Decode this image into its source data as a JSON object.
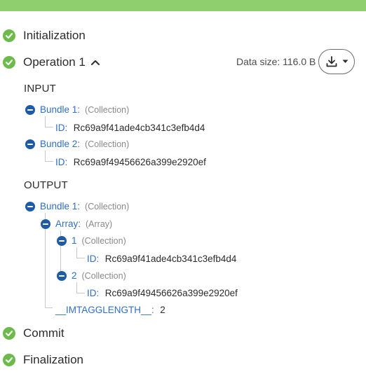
{
  "stages": {
    "initialization": "Initialization",
    "operation": "Operation 1",
    "commit": "Commit",
    "finalization": "Finalization"
  },
  "data_size": "Data size: 116.0 B",
  "icons": {
    "check": "check-circle-icon",
    "caret": "caret-up-icon",
    "download": "download-icon",
    "chevron": "chevron-down-icon",
    "collapse": "minus-circle-icon"
  },
  "colors": {
    "success": "#6cbb4a",
    "link": "#2f6fc2",
    "topbar": "#8fcf6e"
  },
  "input": {
    "heading": "INPUT",
    "bundle1": {
      "key": "Bundle 1:",
      "type": "(Collection)",
      "id_key": "ID:",
      "id_val": "Rc69a9f41ade4cb341c3efb4d4"
    },
    "bundle2": {
      "key": "Bundle 2:",
      "type": "(Collection)",
      "id_key": "ID:",
      "id_val": "Rc69a9f49456626a399e2920ef"
    }
  },
  "output": {
    "heading": "OUTPUT",
    "bundle1": {
      "key": "Bundle 1:",
      "type": "(Collection)"
    },
    "array": {
      "key": "Array:",
      "type": "(Array)"
    },
    "item1": {
      "key": "1",
      "type": "(Collection)",
      "id_key": "ID:",
      "id_val": "Rc69a9f41ade4cb341c3efb4d4"
    },
    "item2": {
      "key": "2",
      "type": "(Collection)",
      "id_key": "ID:",
      "id_val": "Rc69a9f49456626a399e2920ef"
    },
    "length": {
      "key": "__IMTAGGLENGTH__:",
      "val": "2"
    }
  }
}
